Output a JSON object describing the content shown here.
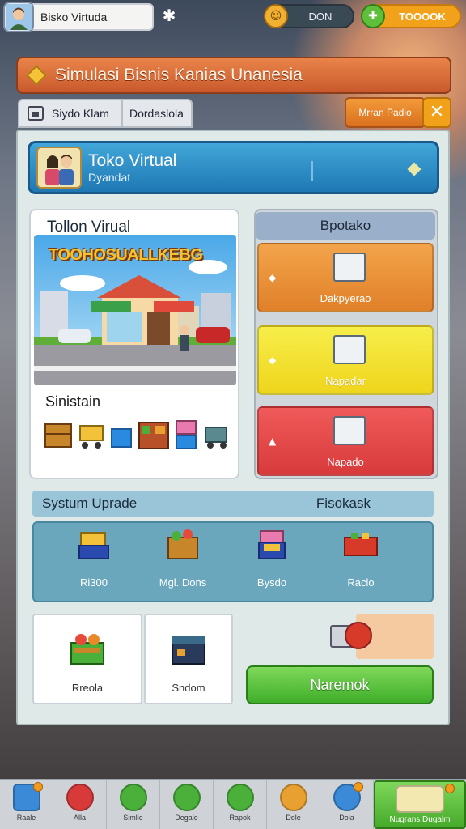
{
  "top_bar": {
    "profile_name": "Bisko Virtuda",
    "coin_value": "DON",
    "cash_value": "TOOOOK"
  },
  "title_banner": {
    "title": "Simulasi Bisnis Kanias Unanesia"
  },
  "tabs": [
    {
      "label": "Siydo Klam"
    },
    {
      "label": "Dordaslola"
    }
  ],
  "header_actions": {
    "orange_button": "Mrran Padio",
    "close_glyph": "✕"
  },
  "shop_header": {
    "title": "Toko Virtual",
    "subtitle": "Dyandat"
  },
  "store_card": {
    "title": "Tollon Virual",
    "scene_banner": "TOOHOSUALLKEBG",
    "sub_label": "Sinistain"
  },
  "right_panel": {
    "header": "Bpotako",
    "cards": [
      {
        "label": "Dakpyerao",
        "color": "#f2a44a"
      },
      {
        "label": "Napadar",
        "color": "#f7ee4a"
      },
      {
        "label": "Napado",
        "color": "#f05a5a"
      }
    ]
  },
  "upgrade": {
    "left_title": "Systum Uprade",
    "right_title": "Fisokask",
    "items": [
      {
        "label": "Ri300",
        "icon": "box-crate-icon"
      },
      {
        "label": "Mgl. Dons",
        "icon": "produce-crate-icon"
      },
      {
        "label": "Bysdo",
        "icon": "stacked-crate-icon"
      },
      {
        "label": "Raclo",
        "icon": "red-basket-icon"
      }
    ]
  },
  "bottom_row": {
    "cards": [
      {
        "label": "Rreola",
        "icon": "fruit-crate-icon"
      },
      {
        "label": "Sndom",
        "icon": "storage-box-icon"
      }
    ],
    "green_button": "Naremok"
  },
  "bottom_nav": [
    {
      "label": "Raale",
      "icon": "shop-icon",
      "color": "#3a8ad8"
    },
    {
      "label": "Alla",
      "icon": "heart-icon",
      "color": "#d83a3a"
    },
    {
      "label": "Simlie",
      "icon": "tools-icon",
      "color": "#4ab03a"
    },
    {
      "label": "Degale",
      "icon": "eraser-icon",
      "color": "#4ab03a"
    },
    {
      "label": "Rapok",
      "icon": "refresh-icon",
      "color": "#4ab03a"
    },
    {
      "label": "Dole",
      "icon": "box-icon",
      "color": "#e8a030"
    },
    {
      "label": "Dola",
      "icon": "globe-icon",
      "color": "#3a8ad8"
    },
    {
      "label": "Nugrans Dugalm",
      "icon": "trade-icon",
      "color": "#46a92a"
    }
  ]
}
